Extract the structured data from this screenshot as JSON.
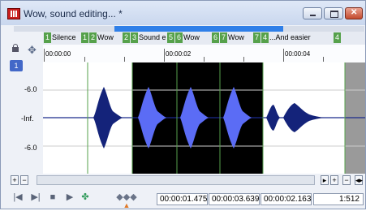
{
  "window": {
    "title": "Wow, sound editing... *"
  },
  "markers": [
    {
      "nums": [
        "1"
      ],
      "label": "Silence"
    },
    {
      "nums": [
        "1",
        "2"
      ],
      "label": "Wow"
    },
    {
      "nums": [
        "2",
        "3"
      ],
      "label": "Sound e"
    },
    {
      "nums": [
        "5",
        "6"
      ],
      "label": "Wow"
    },
    {
      "nums": [
        "6",
        "7"
      ],
      "label": "Wow"
    },
    {
      "nums": [
        "7",
        "4"
      ],
      "label": "...And easier"
    },
    {
      "nums": [
        "4"
      ],
      "label": ""
    }
  ],
  "ruler": {
    "labels": [
      "00:00:00",
      "00:00:02",
      "00:00:04"
    ]
  },
  "channel": {
    "label": "1",
    "db_labels": [
      "-6.0",
      "-Inf.",
      "-6.0"
    ]
  },
  "transport": {
    "start_time": "00:00:01.475",
    "end_time": "00:00:03.639",
    "length": "00:00:02.163",
    "zoom": "1:512"
  },
  "colors": {
    "accent": "#2f7fe8",
    "marker": "#56a14b",
    "waveform": "#14237a",
    "waveform_selected": "#5b6cf5",
    "selection": "#000000"
  }
}
